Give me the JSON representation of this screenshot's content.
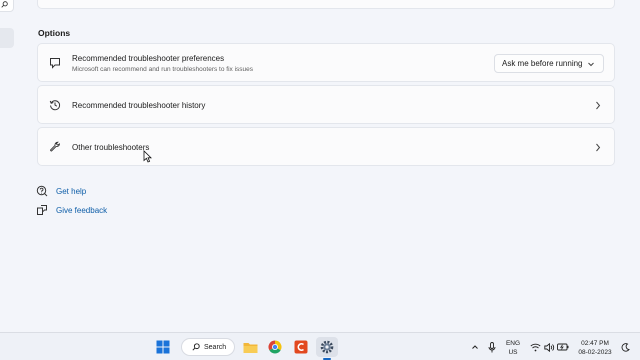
{
  "section": {
    "options_title": "Options"
  },
  "cards": {
    "preferences": {
      "title": "Recommended troubleshooter preferences",
      "subtitle": "Microsoft can recommend and run troubleshooters to fix issues",
      "dropdown_value": "Ask me before running"
    },
    "history": {
      "title": "Recommended troubleshooter history"
    },
    "other": {
      "title": "Other troubleshooters"
    }
  },
  "links": {
    "help": "Get help",
    "feedback": "Give feedback"
  },
  "taskbar": {
    "search_label": "Search",
    "lang_line1": "ENG",
    "lang_line2": "US",
    "time": "02:47 PM",
    "date": "08-02-2023"
  },
  "colors": {
    "accent": "#0e5ea8",
    "background": "#f3f5fa",
    "card": "#fbfbfc"
  }
}
